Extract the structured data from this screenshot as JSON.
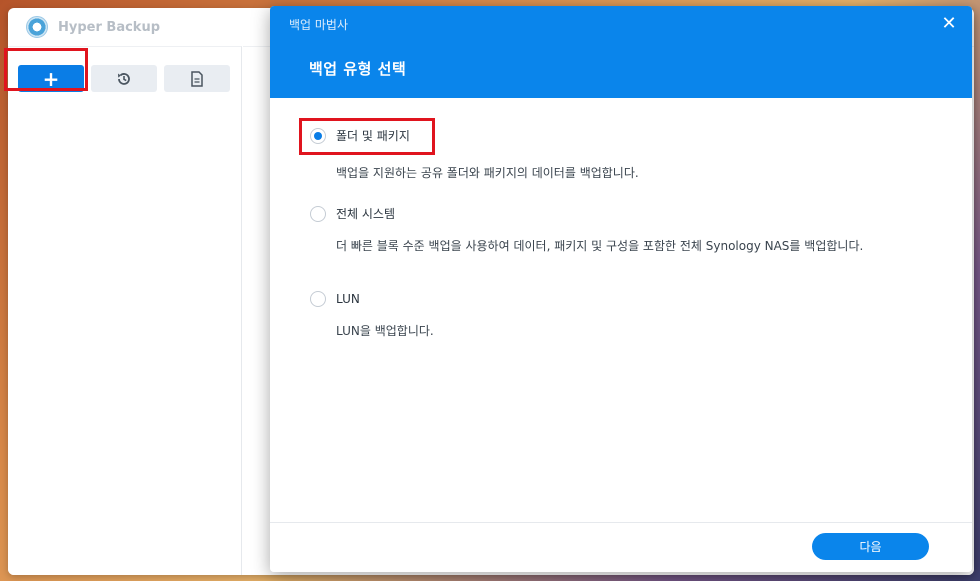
{
  "app": {
    "title": "Hyper Backup",
    "logo_icon": "hyper-backup-logo"
  },
  "toolbar": {
    "add_label": "+",
    "history_icon": "restore-history-icon",
    "log_icon": "document-icon"
  },
  "dialog": {
    "window_title": "백업 마법사",
    "close_label": "✕",
    "step_title": "백업 유형 선택",
    "options": [
      {
        "label": "폴더 및 패키지",
        "description": "백업을 지원하는 공유 폴더와 패키지의 데이터를 백업합니다.",
        "selected": true
      },
      {
        "label": "전체 시스템",
        "description": "더 빠른 블록 수준 백업을 사용하여 데이터, 패키지 및 구성을 포함한 전체 Synology NAS를 백업합니다.",
        "selected": false
      },
      {
        "label": "LUN",
        "description": "LUN을 백업합니다.",
        "selected": false
      }
    ],
    "next_label": "다음"
  },
  "colors": {
    "accent": "#0a85eb",
    "highlight": "#e0141e"
  }
}
